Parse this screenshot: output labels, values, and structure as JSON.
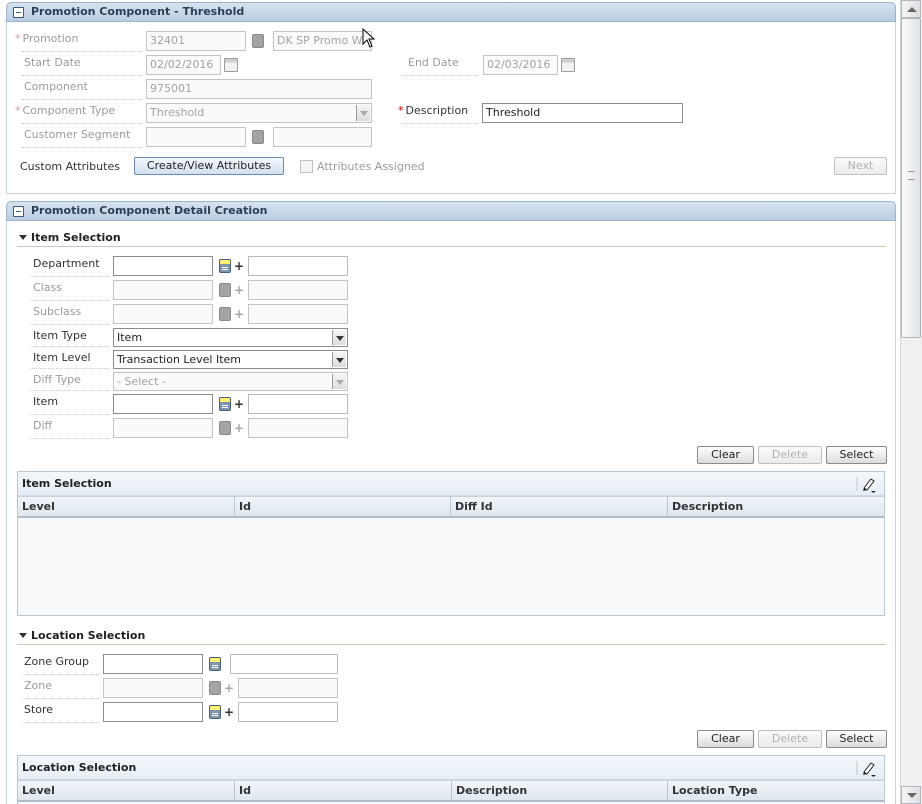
{
  "header_panel": {
    "title": "Promotion Component - Threshold",
    "promotion_label": "Promotion",
    "promotion_value": "32401",
    "promotion_desc": "DK SP Promo W",
    "start_date_label": "Start Date",
    "start_date_value": "02/02/2016",
    "end_date_label": "End Date",
    "end_date_value": "02/03/2016",
    "component_label": "Component",
    "component_value": "975001",
    "component_type_label": "Component Type",
    "component_type_value": "Threshold",
    "description_label": "Description",
    "description_value": "Threshold",
    "customer_segment_label": "Customer Segment",
    "customer_segment_value": "",
    "customer_segment_desc": "",
    "custom_attributes_label": "Custom Attributes",
    "create_view_button": "Create/View Attributes",
    "attributes_assigned_label": "Attributes Assigned",
    "next_button": "Next"
  },
  "detail_panel": {
    "title": "Promotion Component Detail Creation",
    "item_selection": {
      "heading": "Item Selection",
      "department_label": "Department",
      "class_label": "Class",
      "subclass_label": "Subclass",
      "item_type_label": "Item Type",
      "item_type_value": "Item",
      "item_level_label": "Item Level",
      "item_level_value": "Transaction Level Item",
      "diff_type_label": "Diff Type",
      "diff_type_value": "- Select -",
      "item_label": "Item",
      "diff_label": "Diff",
      "clear_button": "Clear",
      "delete_button": "Delete",
      "select_button": "Select",
      "table_title": "Item Selection",
      "columns": [
        "Level",
        "Id",
        "Diff Id",
        "Description"
      ]
    },
    "location_selection": {
      "heading": "Location Selection",
      "zone_group_label": "Zone Group",
      "zone_label": "Zone",
      "store_label": "Store",
      "clear_button": "Clear",
      "delete_button": "Delete",
      "select_button": "Select",
      "table_title": "Location Selection",
      "columns": [
        "Level",
        "Id",
        "Description",
        "Location Type"
      ]
    }
  },
  "colors": {
    "panel_header": "#c6d7e9",
    "required_star": "#cc0000",
    "lov_yellow": "#fff36b"
  }
}
